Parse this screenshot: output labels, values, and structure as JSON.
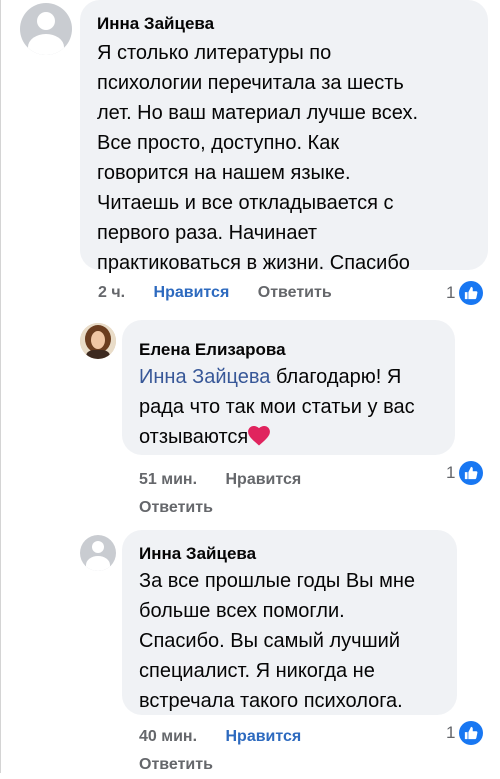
{
  "comments": [
    {
      "author": "Инна Зайцева",
      "lines": [
        "Я столько литературы по",
        "психологии перечитала за шесть",
        "лет. Но ваш материал лучше всех.",
        "Все просто, доступно. Как",
        "говорится на нашем языке.",
        "Читаешь и все откладывается с",
        "первого раза. Начинает",
        "практиковаться в жизни. Спасибо"
      ],
      "time": "2 ч.",
      "like_label": "Нравится",
      "reply_label": "Ответить",
      "likes": "1"
    },
    {
      "author": "Елена Елизарова",
      "mention": "Инна Зайцева",
      "lines": [
        " благодарю! Я",
        "рада что так мои статьи у вас",
        "отзываются"
      ],
      "time": "51 мин.",
      "like_label": "Нравится",
      "reply_label": "Ответить",
      "likes": "1"
    },
    {
      "author": "Инна Зайцева",
      "lines": [
        "За все прошлые годы Вы мне",
        "больше всех помогли.",
        "Спасибо. Вы самый лучший",
        "специалист. Я никогда не",
        "встречала такого психолога."
      ],
      "time": "40 мин.",
      "like_label": "Нравится",
      "reply_label": "Ответить",
      "likes": "1"
    }
  ],
  "colors": {
    "bubble": "#f0f2f5",
    "link": "#2d6abf",
    "like_badge": "#1877f2",
    "heart": "#e0245e"
  },
  "icons": [
    "default-avatar-icon",
    "user-photo-avatar",
    "thumbs-up-icon",
    "heart-emoji-icon"
  ]
}
